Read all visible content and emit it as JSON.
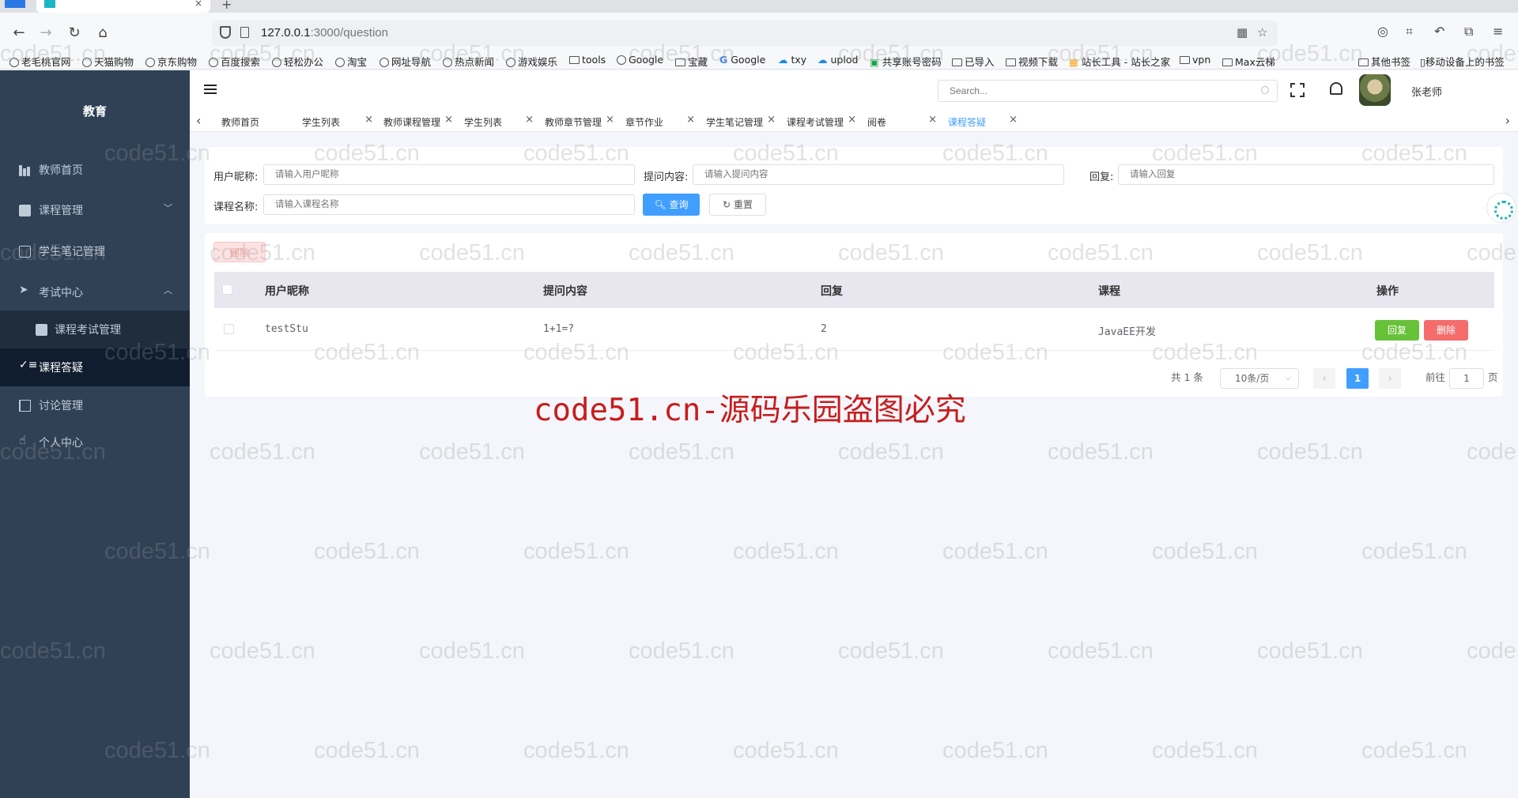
{
  "browser": {
    "url_host": "127.0.0.1",
    "url_rest": ":3000/question",
    "tab_close": "×",
    "new_tab": "+",
    "bookmarks": [
      "老毛桃官网",
      "天猫购物",
      "京东购物",
      "百度搜索",
      "轻松办公",
      "淘宝",
      "网址导航",
      "热点新闻",
      "游戏娱乐",
      "tools",
      "Google",
      "宝藏",
      "Google",
      "txy",
      "uplod",
      "共享账号密码",
      "已导入",
      "视频下载",
      "站长工具 - 站长之家",
      "vpn",
      "Max云梯",
      "其他书签",
      "移动设备上的书签"
    ]
  },
  "sidebar": {
    "brand": "教育",
    "items": [
      {
        "label": "教师首页",
        "icon": "bar-chart-icon"
      },
      {
        "label": "课程管理",
        "icon": "clipboard-icon",
        "chevron": "﹀"
      },
      {
        "label": "学生笔记管理",
        "icon": "document-icon"
      },
      {
        "label": "考试中心",
        "icon": "send-icon",
        "chevron": "︿"
      },
      {
        "label": "课程考试管理",
        "icon": "clipboard-icon"
      },
      {
        "label": "课程答疑",
        "icon": "checklist-icon"
      },
      {
        "label": "讨论管理",
        "icon": "book-icon"
      },
      {
        "label": "个人中心",
        "icon": "hand-icon"
      }
    ]
  },
  "header": {
    "search_placeholder": "Search...",
    "user_name": "张老师"
  },
  "tags": [
    {
      "label": "教师首页",
      "close": ""
    },
    {
      "label": "学生列表",
      "close": "×"
    },
    {
      "label": "教师课程管理",
      "close": "×"
    },
    {
      "label": "学生列表",
      "close": "×"
    },
    {
      "label": "教师章节管理",
      "close": "×"
    },
    {
      "label": "章节作业",
      "close": "×"
    },
    {
      "label": "学生笔记管理",
      "close": "×"
    },
    {
      "label": "课程考试管理",
      "close": "×"
    },
    {
      "label": "阅卷",
      "close": "×"
    },
    {
      "label": "课程答疑",
      "close": "×"
    }
  ],
  "filters": {
    "nickname_label": "用户昵称:",
    "nickname_placeholder": "请输入用户昵称",
    "content_label": "提问内容:",
    "content_placeholder": "请输入提问内容",
    "reply_label": "回复:",
    "reply_placeholder": "请输入回复",
    "course_label": "课程名称:",
    "course_placeholder": "请输入课程名称",
    "search_button": "查询",
    "reset_button": "重置"
  },
  "actions": {
    "delete_all": "删除"
  },
  "table": {
    "columns": [
      "用户昵称",
      "提问内容",
      "回复",
      "课程",
      "操作"
    ],
    "rows": [
      {
        "nickname": "testStu",
        "content": "1+1=?",
        "reply": "2",
        "course": "JavaEE开发",
        "reply_btn": "回复",
        "delete_btn": "删除"
      }
    ]
  },
  "pagination": {
    "total_text": "共 1 条",
    "page_size": "10条/页",
    "current_page": "1",
    "goto_label": "前往",
    "goto_value": "1",
    "page_suffix": "页",
    "prev": "‹",
    "next": "›"
  },
  "watermark": {
    "repeat": "code51.cn",
    "main": "code51.cn-源码乐园盗图必究"
  },
  "colors": {
    "sidebar_bg": "#304156",
    "primary": "#409eff",
    "success": "#67c23a",
    "danger": "#f56c6c",
    "watermark_red": "#c81c1c"
  }
}
